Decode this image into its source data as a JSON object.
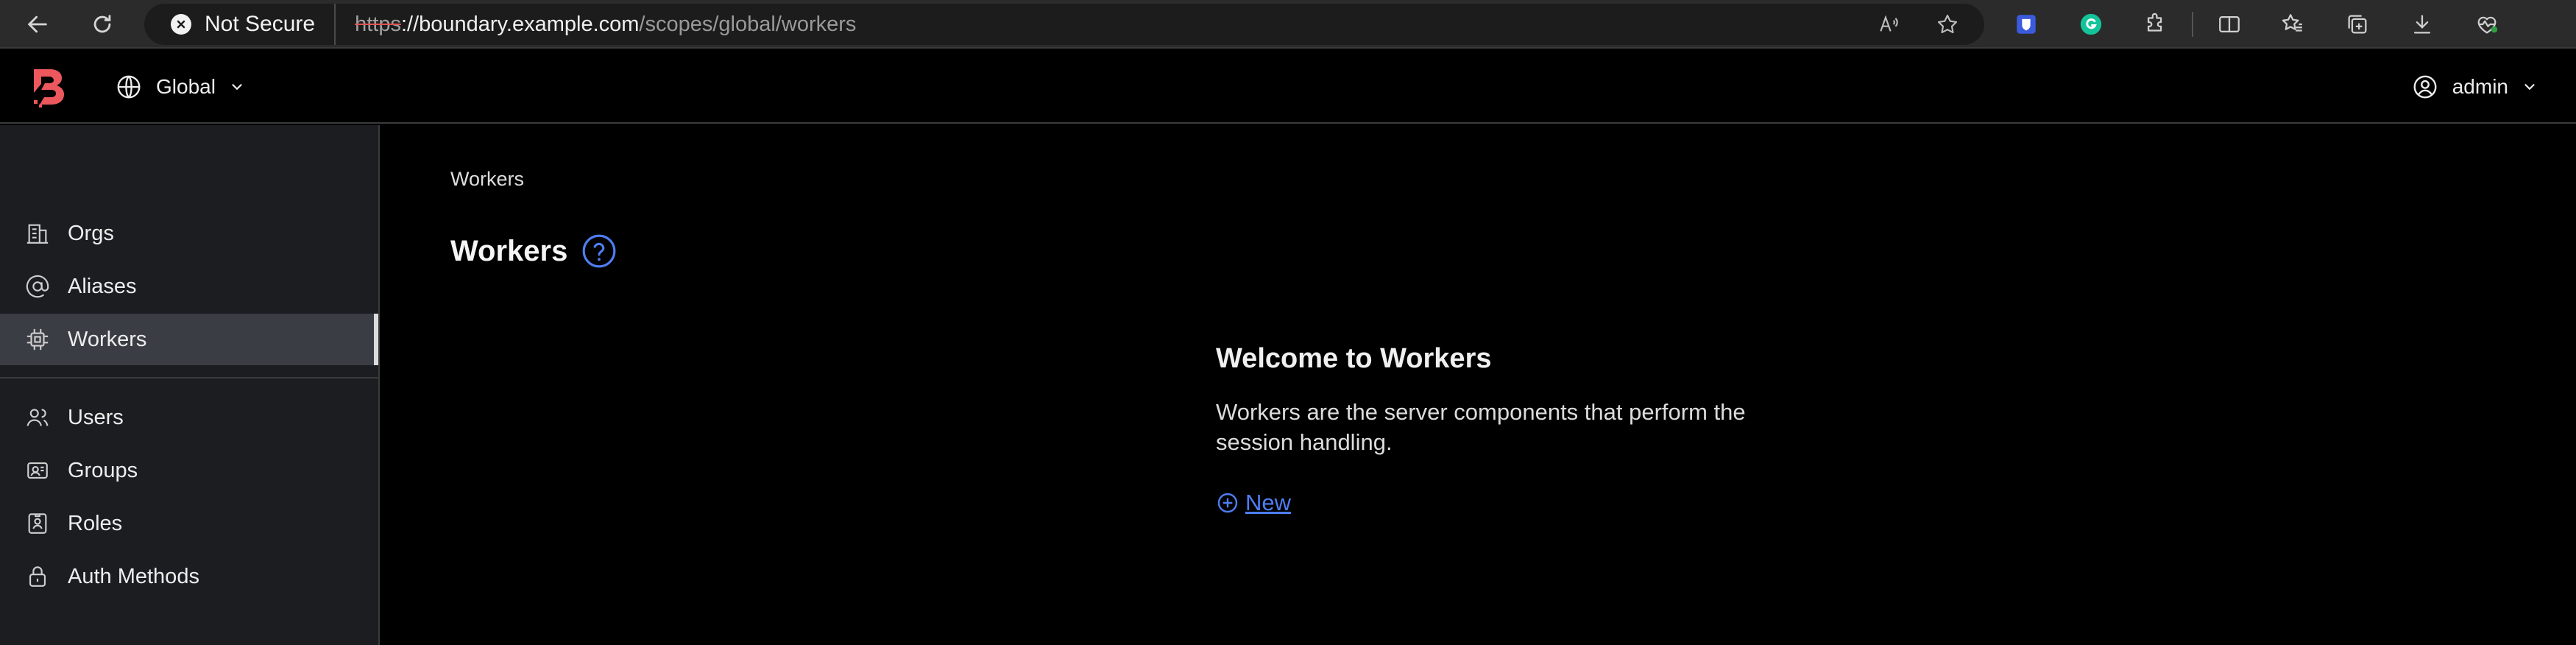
{
  "browser": {
    "security_label": "Not Secure",
    "url_protocol": "https",
    "url_host": "://boundary.example.com",
    "url_path": "/scopes/global/workers",
    "icons": [
      "back-icon",
      "reload-icon",
      "read-aloud-icon",
      "favorite-star-icon",
      "bitwarden-icon",
      "grammarly-icon",
      "extensions-icon",
      "split-screen-icon",
      "favorites-icon",
      "collections-icon",
      "downloads-icon",
      "browser-essentials-icon"
    ]
  },
  "header": {
    "scope_label": "Global",
    "user_label": "admin",
    "brand_color": "#ec585d"
  },
  "sidebar": {
    "items": [
      {
        "label": "Orgs",
        "icon": "building-icon"
      },
      {
        "label": "Aliases",
        "icon": "at-sign-icon"
      },
      {
        "label": "Workers",
        "icon": "cpu-icon",
        "active": true
      },
      {
        "label": "Users",
        "icon": "users-icon"
      },
      {
        "label": "Groups",
        "icon": "groups-icon"
      },
      {
        "label": "Roles",
        "icon": "id-badge-icon"
      },
      {
        "label": "Auth Methods",
        "icon": "lock-icon"
      }
    ]
  },
  "main": {
    "breadcrumb": "Workers",
    "title": "Workers",
    "empty_state": {
      "title": "Welcome to Workers",
      "body": "Workers are the server components that perform the session handling.",
      "action_label": " New"
    },
    "link_color": "#4f7df3"
  }
}
